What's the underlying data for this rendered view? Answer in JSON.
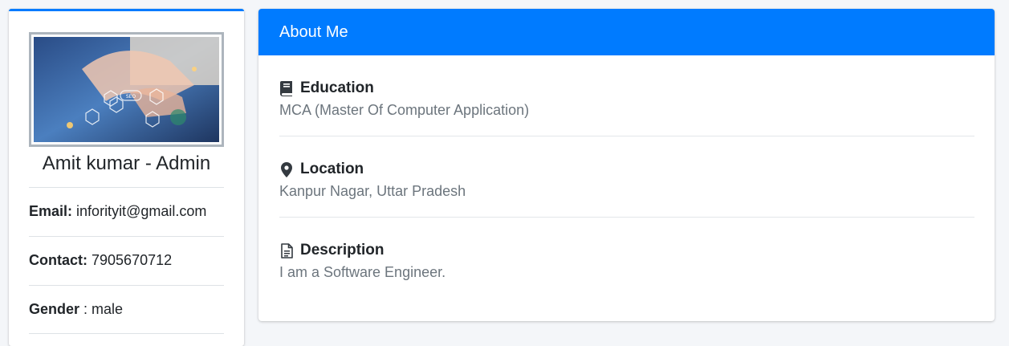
{
  "profile": {
    "name": "Amit kumar - Admin",
    "avatar_alt": "SEO",
    "fields": [
      {
        "label": "Email:",
        "value": "inforityit@gmail.com"
      },
      {
        "label": "Contact:",
        "value": "7905670712"
      },
      {
        "label": "Gender",
        "value": ": male"
      }
    ]
  },
  "about": {
    "title": "About Me",
    "sections": [
      {
        "title": "Education",
        "icon": "book-icon",
        "text": "MCA (Master Of Computer Application)"
      },
      {
        "title": "Location",
        "icon": "map-marker-icon",
        "text": "Kanpur Nagar, Uttar Pradesh"
      },
      {
        "title": "Description",
        "icon": "file-text-icon",
        "text": "I am a Software Engineer."
      }
    ]
  },
  "colors": {
    "primary": "#007bff",
    "muted_text": "#6c757d",
    "background": "#f4f6f9"
  }
}
